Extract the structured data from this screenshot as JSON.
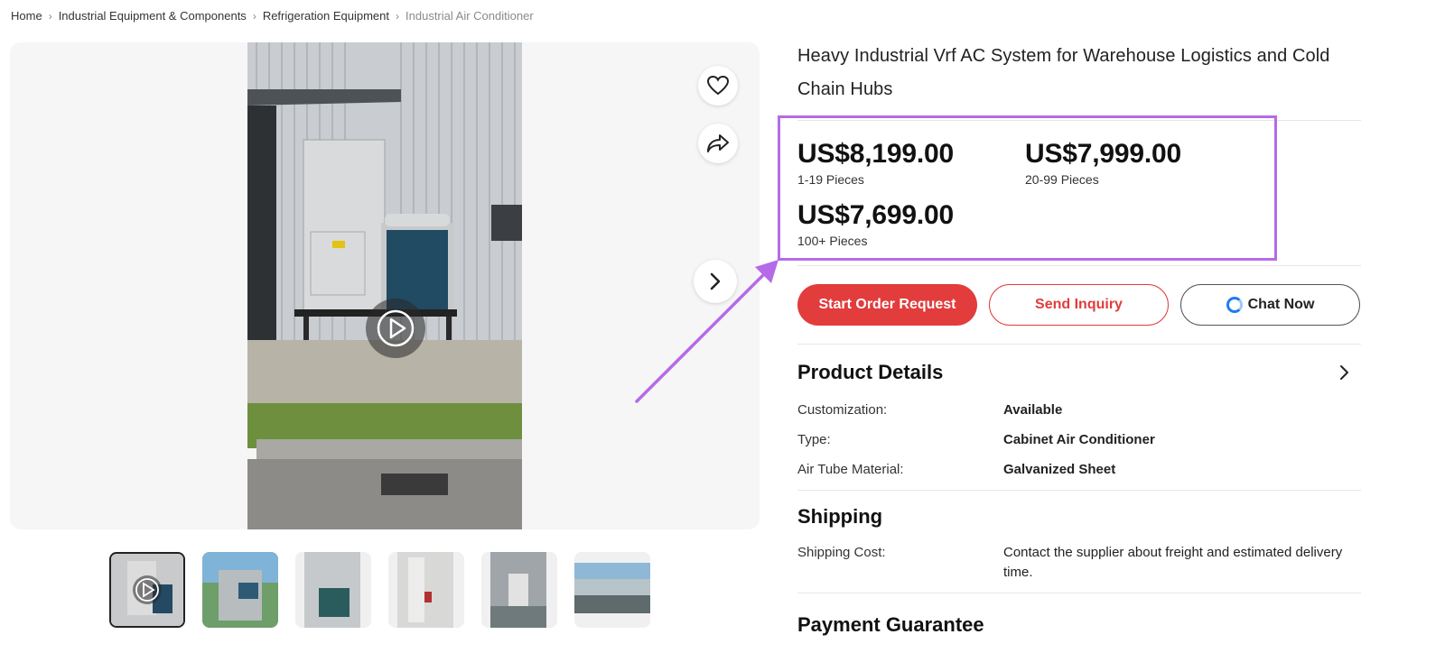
{
  "breadcrumb": [
    "Home",
    "Industrial Equipment & Components",
    "Refrigeration Equipment",
    "Industrial Air Conditioner"
  ],
  "product": {
    "title": "Heavy Industrial Vrf AC System for Warehouse Logistics and Cold Chain Hubs"
  },
  "price_tiers": [
    {
      "amount": "US$8,199.00",
      "qty": "1-19 Pieces"
    },
    {
      "amount": "US$7,999.00",
      "qty": "20-99 Pieces"
    },
    {
      "amount": "US$7,699.00",
      "qty": "100+ Pieces"
    }
  ],
  "actions": {
    "order": "Start Order Request",
    "inquiry": "Send Inquiry",
    "chat": "Chat Now"
  },
  "details": {
    "title": "Product Details",
    "rows": [
      {
        "label": "Customization:",
        "value": "Available"
      },
      {
        "label": "Type:",
        "value": "Cabinet Air Conditioner"
      },
      {
        "label": "Air Tube Material:",
        "value": "Galvanized Sheet"
      }
    ]
  },
  "shipping": {
    "title": "Shipping",
    "label": "Shipping Cost:",
    "value": "Contact the supplier about freight and estimated delivery time."
  },
  "payment": {
    "title": "Payment Guarantee"
  },
  "colors": {
    "accent_red": "#e23c3c",
    "highlight_purple": "#b56be8",
    "chat_blue": "#1e7bf2"
  },
  "icons": [
    "heart-icon",
    "share-icon",
    "chevron-right-icon",
    "play-icon",
    "chat-icon"
  ]
}
